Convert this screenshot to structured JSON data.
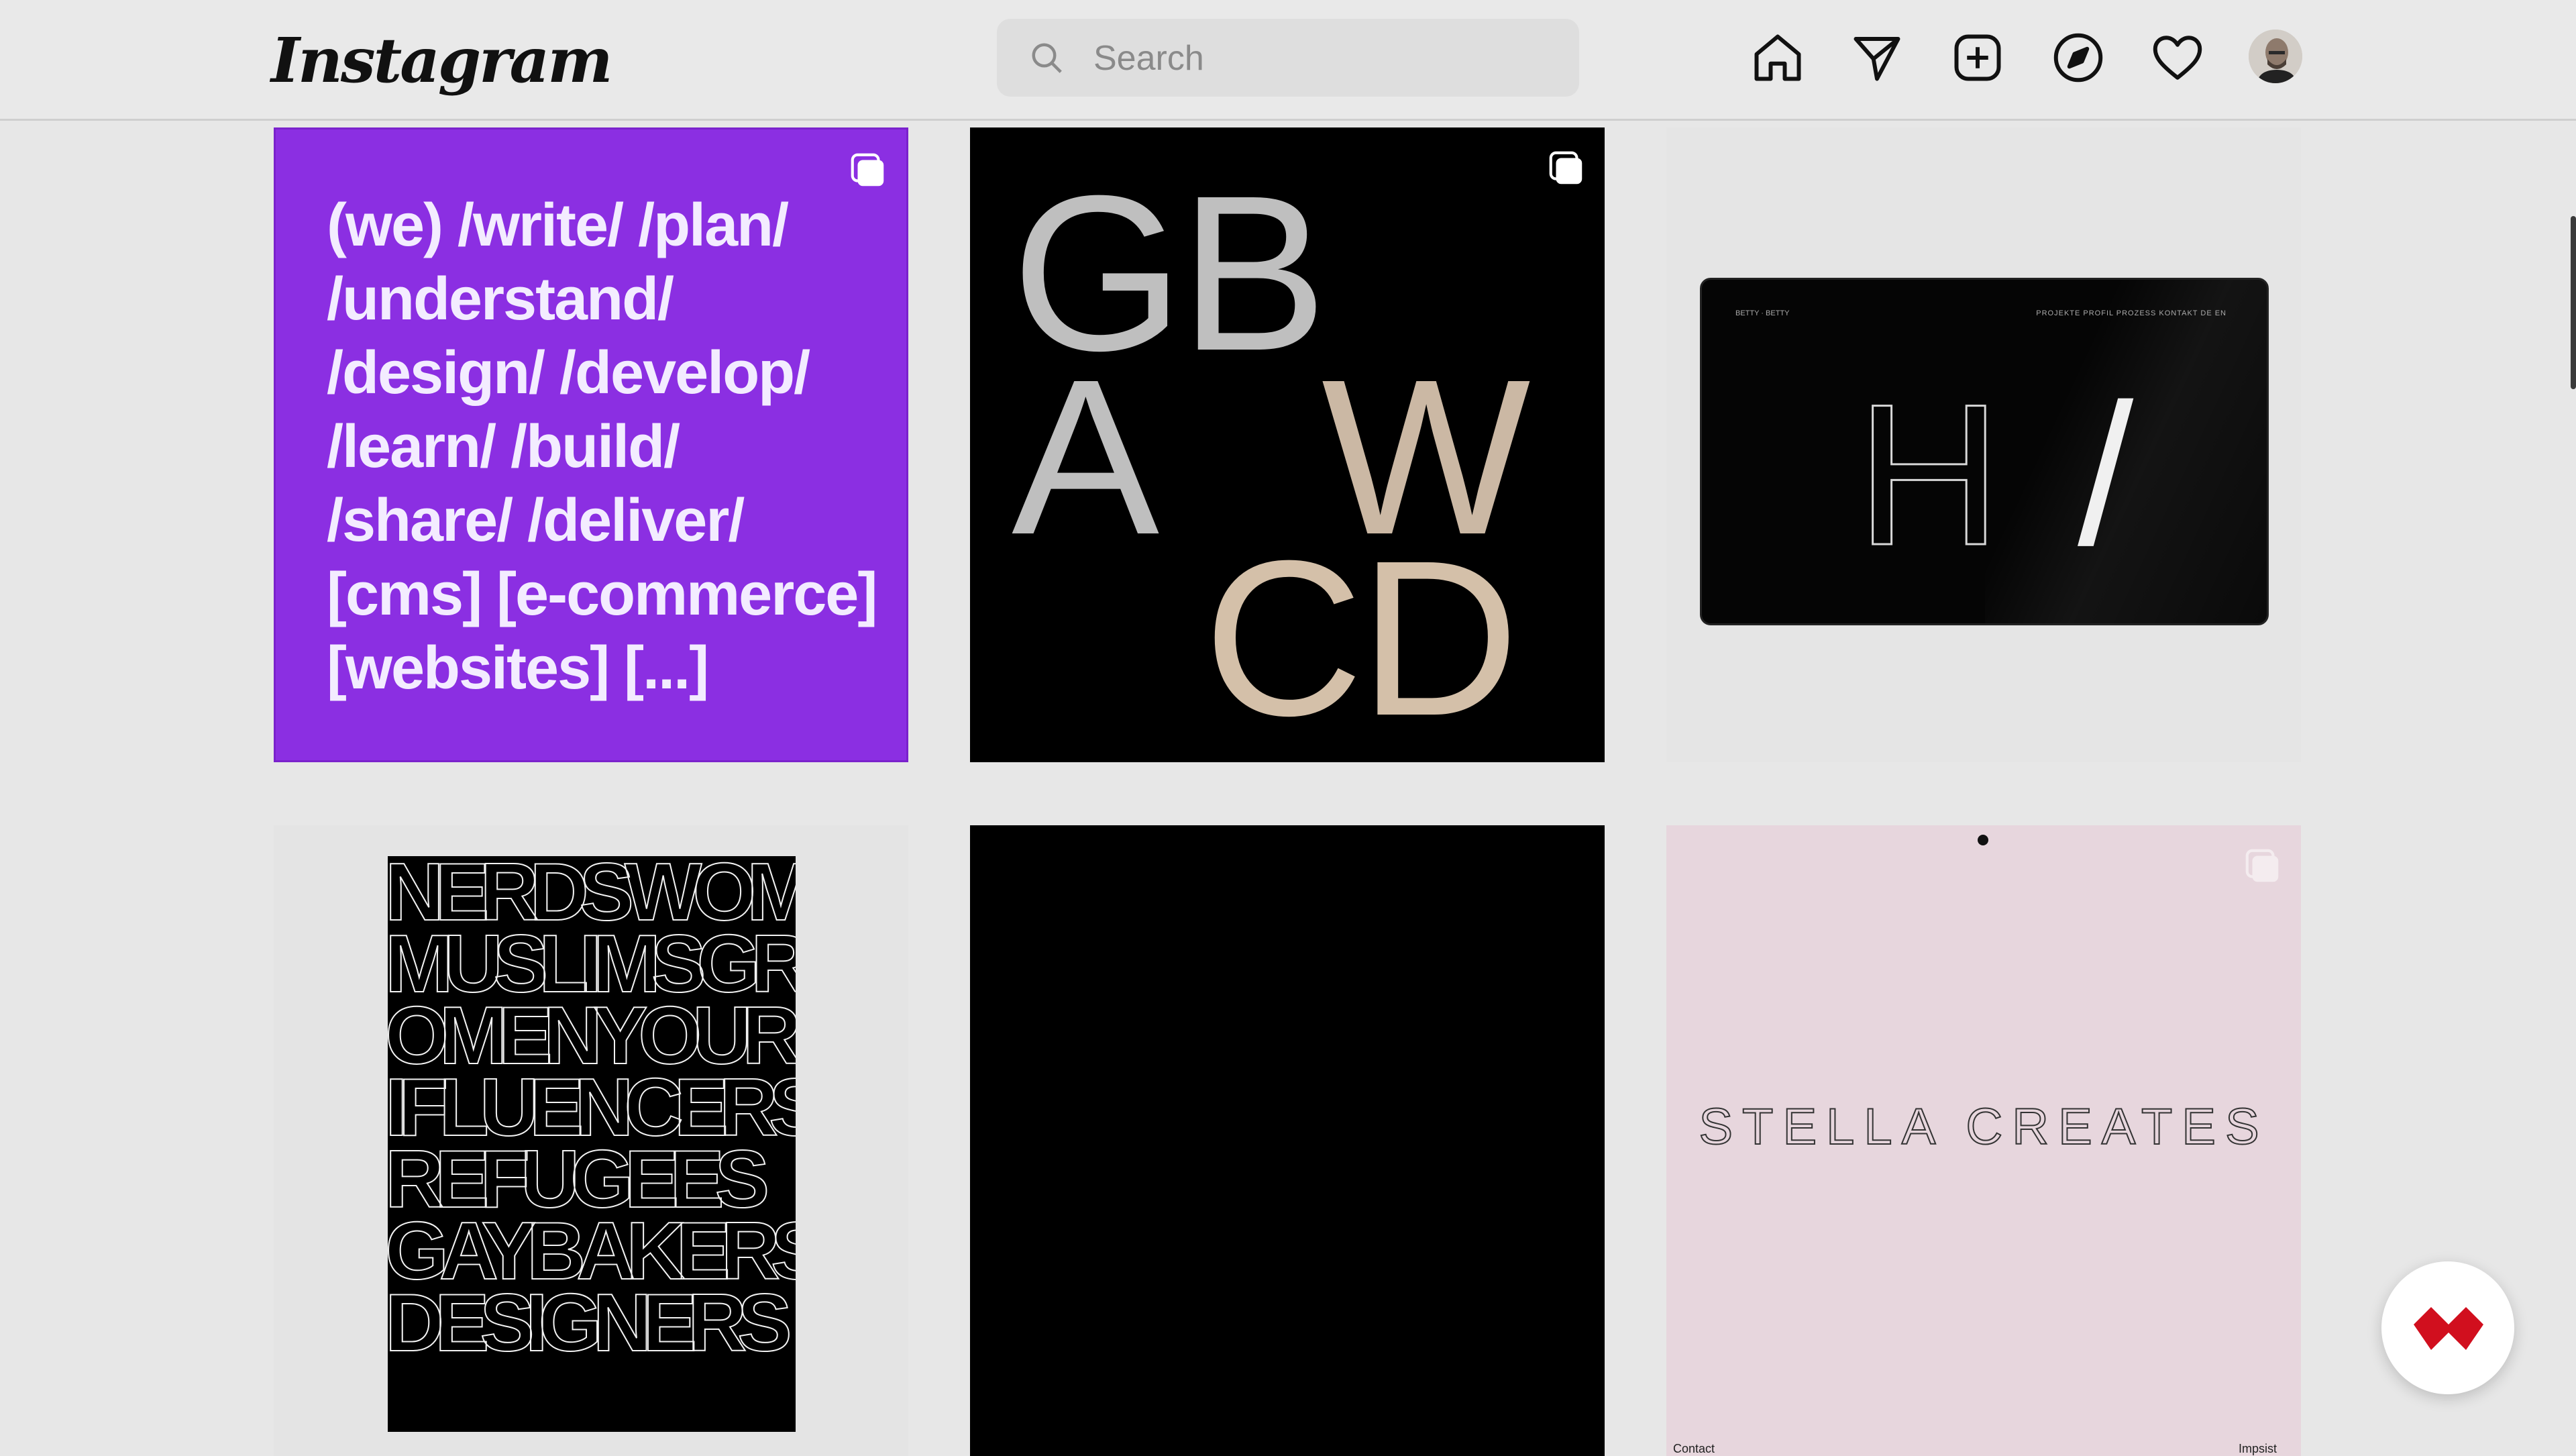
{
  "app": {
    "logo_text": "Instagram",
    "brand_colors": {
      "top_bar": "#e9e9e9",
      "accent_purple": "#8b2fe2",
      "fab_red": "#d10f1e"
    }
  },
  "search": {
    "placeholder": "Search",
    "value": ""
  },
  "nav": {
    "icons": [
      "home-icon",
      "direct-message-icon",
      "new-post-icon",
      "explore-icon",
      "activity-heart-icon",
      "profile-avatar"
    ]
  },
  "grid": {
    "tile1": {
      "lines": [
        "(we)  /write/  /plan/",
        "/understand/",
        "/design/  /develop/",
        "/learn/  /build/",
        "/share/  /deliver/",
        "[cms]  [e-commerce]",
        "[websites]  [...]"
      ],
      "multi_post": true
    },
    "tile2": {
      "letters": [
        "GB",
        "A",
        "W",
        "CD"
      ],
      "multi_post": true
    },
    "tile3": {
      "screen_brand": "BETTY · BETTY",
      "screen_menu": "PROJEKTE  PROFIL  PROZESS  KONTAKT  DE  EN",
      "screen_headline_outline": "H",
      "screen_headline_fill": "/"
    },
    "tile4": {
      "poster_lines": [
        "NERDSWOMEN",
        "MUSLIMSGRI",
        "OMENYOUR",
        "IFLUENCERS",
        "REFUGEES",
        "GAYBAKERS",
        "DESIGNERS"
      ]
    },
    "tile5": {},
    "tile6": {
      "headline": "STELLA CREATES",
      "footer_left": "Contact",
      "footer_right": "Impsist",
      "multi_post": true
    }
  },
  "fab": {
    "icon": "chevron-logo-icon"
  }
}
